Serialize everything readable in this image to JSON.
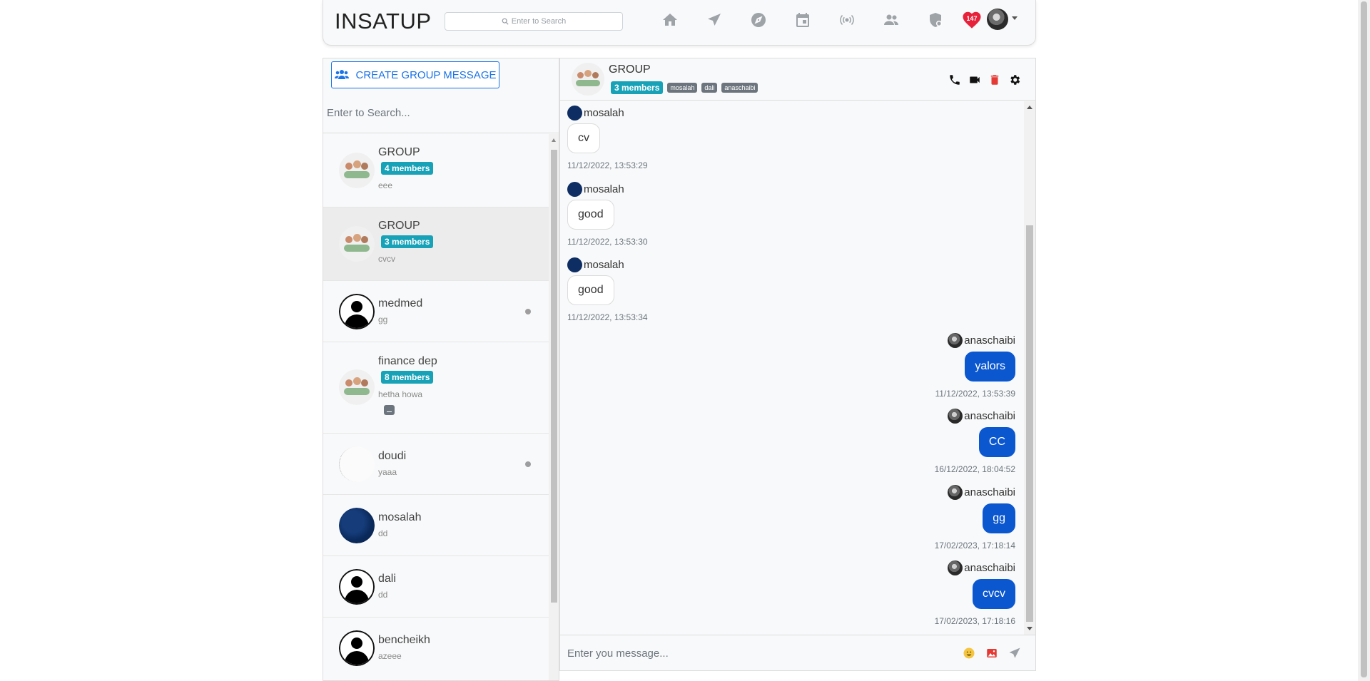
{
  "navbar": {
    "brand": "INSATUP",
    "search_placeholder": "Enter to Search",
    "icons": [
      "home-icon",
      "send-icon",
      "explore-icon",
      "calendar-icon",
      "live-icon",
      "people-icon",
      "shield-icon"
    ],
    "notification_count": "147",
    "accent": "#e8213a"
  },
  "left": {
    "create_label": "CREATE GROUP MESSAGE",
    "search_placeholder": "Enter to Search...",
    "conversations": [
      {
        "name": "GROUP",
        "members": "4 members",
        "last": "eee",
        "type": "group"
      },
      {
        "name": "GROUP",
        "members": "3 members",
        "last": "cvcv",
        "type": "group",
        "active": true
      },
      {
        "name": "medmed",
        "last": "gg",
        "type": "user"
      },
      {
        "name": "finance dep",
        "members": "8 members",
        "last": "hetha howa",
        "type": "group"
      },
      {
        "name": "doudi",
        "last": "yaaa",
        "type": "user"
      },
      {
        "name": "mosalah",
        "last": "dd",
        "type": "user"
      },
      {
        "name": "dali",
        "last": "dd",
        "type": "user"
      },
      {
        "name": "bencheikh",
        "last": "azeee",
        "type": "user"
      }
    ]
  },
  "chat": {
    "title": "GROUP",
    "members": "3 members",
    "member_tags": [
      "mosalah",
      "dali",
      "anaschaibi"
    ],
    "messages": [
      {
        "sender": "mosalah",
        "text": "cv",
        "time": "11/12/2022, 13:53:29",
        "dir": "in"
      },
      {
        "sender": "mosalah",
        "text": "good",
        "time": "11/12/2022, 13:53:30",
        "dir": "in"
      },
      {
        "sender": "mosalah",
        "text": "good",
        "time": "11/12/2022, 13:53:34",
        "dir": "in"
      },
      {
        "sender": "anaschaibi",
        "text": "yalors",
        "time": "11/12/2022, 13:53:39",
        "dir": "out"
      },
      {
        "sender": "anaschaibi",
        "text": "CC",
        "time": "16/12/2022, 18:04:52",
        "dir": "out"
      },
      {
        "sender": "anaschaibi",
        "text": "gg",
        "time": "17/02/2023, 17:18:14",
        "dir": "out"
      },
      {
        "sender": "anaschaibi",
        "text": "cvcv",
        "time": "17/02/2023, 17:18:16",
        "dir": "out"
      }
    ],
    "composer_placeholder": "Enter you message...",
    "out_bubble_color": "#0b57d0"
  }
}
